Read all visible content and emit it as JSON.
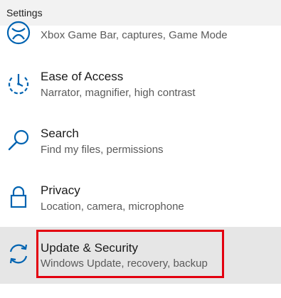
{
  "window": {
    "title": "Settings"
  },
  "colors": {
    "accent": "#0063b1",
    "selected_bg": "#e6e6e6",
    "highlight": "#e3000f"
  },
  "items": [
    {
      "icon": "xbox-icon",
      "label": "",
      "description": "Xbox Game Bar, captures, Game Mode"
    },
    {
      "icon": "ease-of-access-icon",
      "label": "Ease of Access",
      "description": "Narrator, magnifier, high contrast"
    },
    {
      "icon": "search-icon",
      "label": "Search",
      "description": "Find my files, permissions"
    },
    {
      "icon": "lock-icon",
      "label": "Privacy",
      "description": "Location, camera, microphone"
    },
    {
      "icon": "sync-icon",
      "label": "Update & Security",
      "description": "Windows Update, recovery, backup",
      "selected": true
    }
  ]
}
